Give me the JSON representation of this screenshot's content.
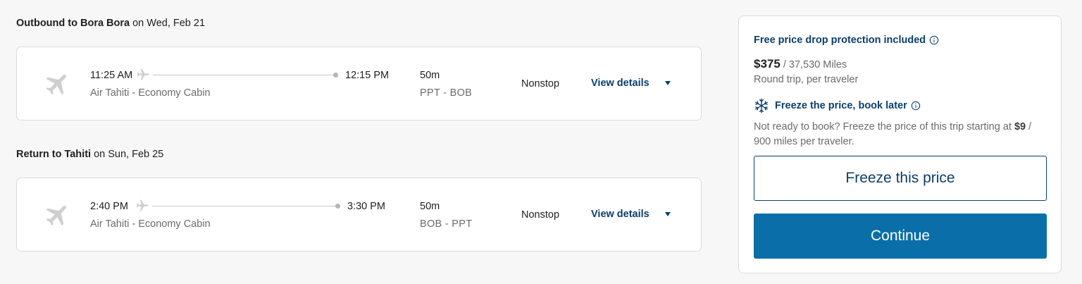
{
  "outbound": {
    "heading_bold": "Outbound to Bora Bora",
    "heading_rest": " on Wed, Feb 21",
    "depart_time": "11:25 AM",
    "arrive_time": "12:15 PM",
    "airline": "Air Tahiti - Economy Cabin",
    "duration": "50m",
    "airports": "PPT - BOB",
    "stops": "Nonstop",
    "details_label": "View details"
  },
  "return": {
    "heading_bold": "Return to Tahiti",
    "heading_rest": " on Sun, Feb 25",
    "depart_time": "2:40 PM",
    "arrive_time": "3:30 PM",
    "airline": "Air Tahiti - Economy Cabin",
    "duration": "50m",
    "airports": "BOB - PPT",
    "stops": "Nonstop",
    "details_label": "View details"
  },
  "summary": {
    "protection_label": "Free price drop protection included",
    "price": "$375",
    "miles": " / 37,530 Miles",
    "trip_note": "Round trip, per traveler",
    "freeze_heading": "Freeze the price, book later",
    "freeze_desc_start": "Not ready to book? Freeze the price of this trip starting at ",
    "freeze_price": "$9",
    "freeze_desc_end": " / 900 miles per traveler.",
    "freeze_button": "Freeze this price",
    "continue_button": "Continue"
  },
  "icons": {
    "plane": "airplane-icon",
    "info": "info-icon",
    "snowflake": "snowflake-icon",
    "caret": "caret-down-icon"
  },
  "colors": {
    "brand_navy": "#0b3f6b",
    "primary_blue": "#0a6ea8",
    "muted_text": "#6b6b6b",
    "plane_gray": "#cfcfcf"
  }
}
